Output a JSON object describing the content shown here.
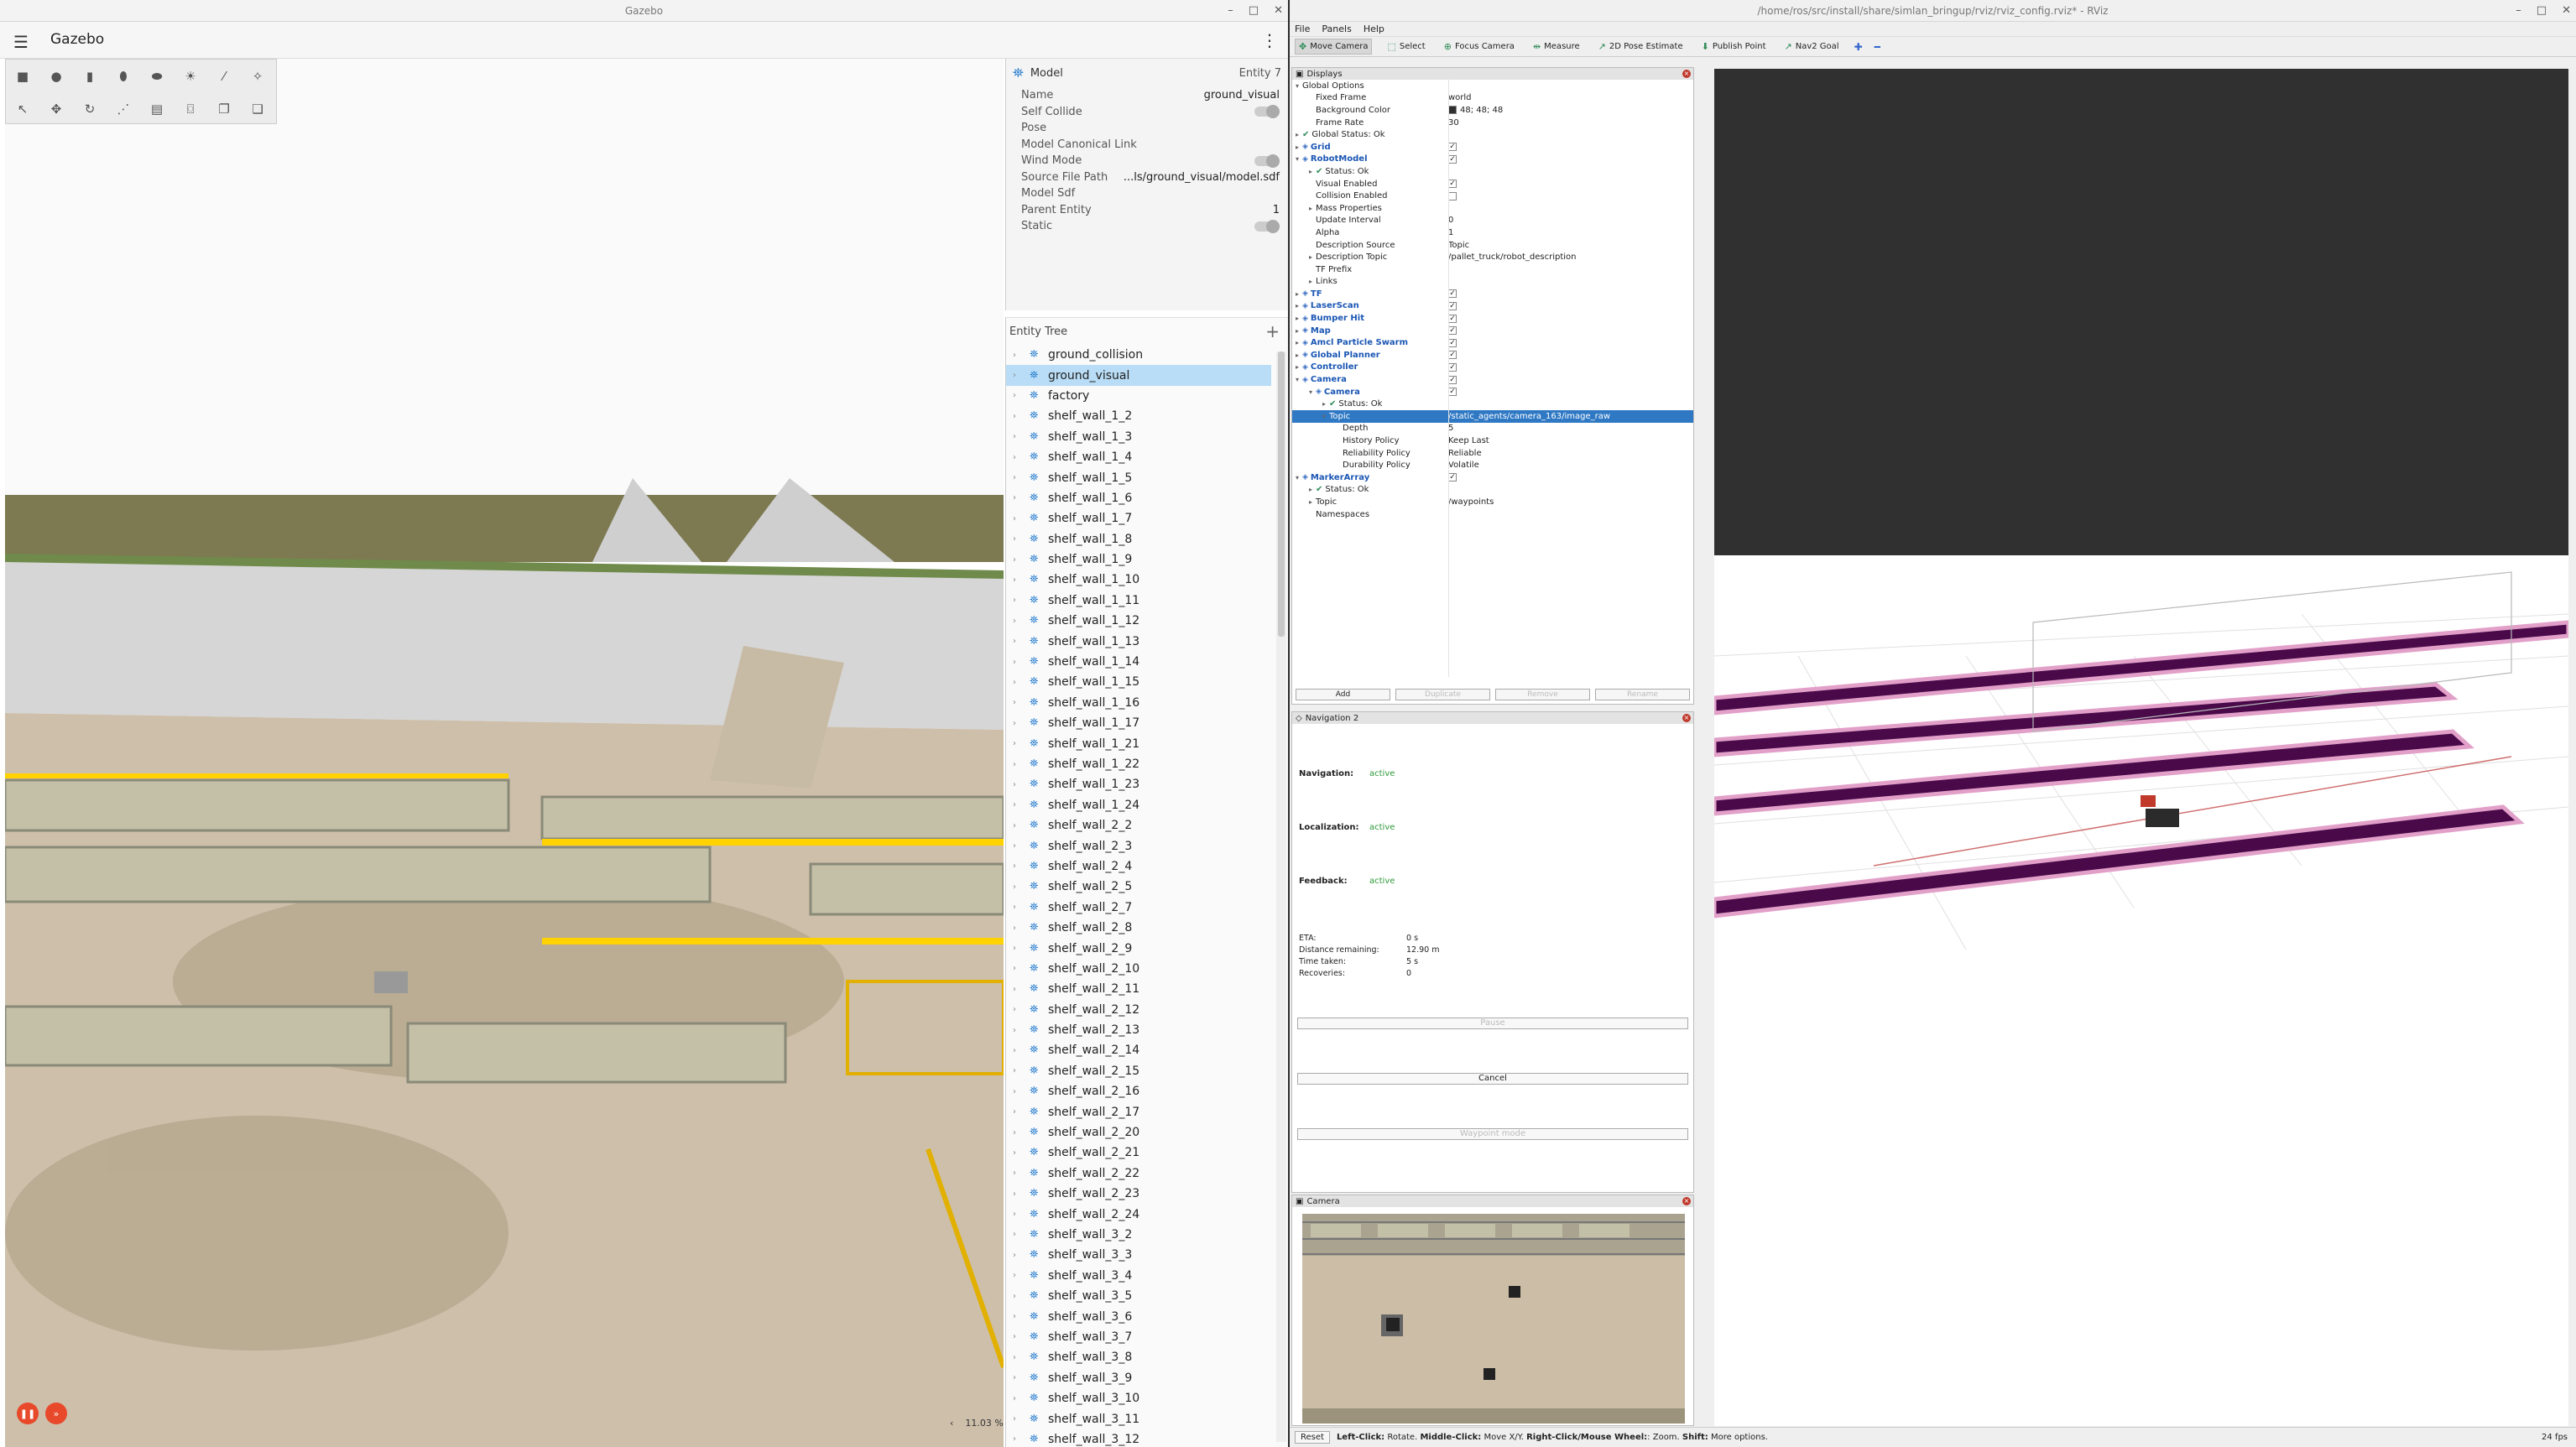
{
  "gazebo": {
    "window_title": "Gazebo",
    "app_title": "Gazebo",
    "zoom": "11.03 %",
    "component_inspector": {
      "title": "Model",
      "entity": "Entity 7",
      "props": [
        {
          "key": "Name",
          "value": "ground_visual",
          "toggle": false
        },
        {
          "key": "Self Collide",
          "value": "",
          "toggle": true
        },
        {
          "key": "Pose",
          "value": "",
          "toggle": false,
          "expand": true
        },
        {
          "key": "Model Canonical Link",
          "value": "",
          "toggle": false
        },
        {
          "key": "Wind Mode",
          "value": "",
          "toggle": true
        },
        {
          "key": "Source File Path",
          "value": "...ls/ground_visual/model.sdf",
          "toggle": false
        },
        {
          "key": "Model Sdf",
          "value": "",
          "toggle": false
        },
        {
          "key": "Parent Entity",
          "value": "1",
          "toggle": false
        },
        {
          "key": "Static",
          "value": "",
          "toggle": true
        }
      ]
    },
    "entity_tree": {
      "title": "Entity Tree",
      "items": [
        "ground_collision",
        "ground_visual",
        "factory",
        "shelf_wall_1_2",
        "shelf_wall_1_3",
        "shelf_wall_1_4",
        "shelf_wall_1_5",
        "shelf_wall_1_6",
        "shelf_wall_1_7",
        "shelf_wall_1_8",
        "shelf_wall_1_9",
        "shelf_wall_1_10",
        "shelf_wall_1_11",
        "shelf_wall_1_12",
        "shelf_wall_1_13",
        "shelf_wall_1_14",
        "shelf_wall_1_15",
        "shelf_wall_1_16",
        "shelf_wall_1_17",
        "shelf_wall_1_21",
        "shelf_wall_1_22",
        "shelf_wall_1_23",
        "shelf_wall_1_24",
        "shelf_wall_2_2",
        "shelf_wall_2_3",
        "shelf_wall_2_4",
        "shelf_wall_2_5",
        "shelf_wall_2_7",
        "shelf_wall_2_8",
        "shelf_wall_2_9",
        "shelf_wall_2_10",
        "shelf_wall_2_11",
        "shelf_wall_2_12",
        "shelf_wall_2_13",
        "shelf_wall_2_14",
        "shelf_wall_2_15",
        "shelf_wall_2_16",
        "shelf_wall_2_17",
        "shelf_wall_2_20",
        "shelf_wall_2_21",
        "shelf_wall_2_22",
        "shelf_wall_2_23",
        "shelf_wall_2_24",
        "shelf_wall_3_2",
        "shelf_wall_3_3",
        "shelf_wall_3_4",
        "shelf_wall_3_5",
        "shelf_wall_3_6",
        "shelf_wall_3_7",
        "shelf_wall_3_8",
        "shelf_wall_3_9",
        "shelf_wall_3_10",
        "shelf_wall_3_11",
        "shelf_wall_3_12"
      ],
      "selected": "ground_visual"
    }
  },
  "rviz": {
    "window_title": "/home/ros/src/install/share/simlan_bringup/rviz/rviz_config.rviz* - RViz",
    "menu": [
      "File",
      "Panels",
      "Help"
    ],
    "tools": [
      "Move Camera",
      "Select",
      "Focus Camera",
      "Measure",
      "2D Pose Estimate",
      "Publish Point",
      "Nav2 Goal"
    ],
    "displays": {
      "title": "Displays",
      "rows": [
        {
          "indent": 0,
          "arrow": "▾",
          "label": "Global Options",
          "value": "",
          "bold": false,
          "check": null
        },
        {
          "indent": 1,
          "arrow": "",
          "label": "Fixed Frame",
          "value": "world",
          "bold": false,
          "check": null
        },
        {
          "indent": 1,
          "arrow": "",
          "label": "Background Color",
          "value": "48; 48; 48",
          "bold": false,
          "check": null,
          "swatch": true
        },
        {
          "indent": 1,
          "arrow": "",
          "label": "Frame Rate",
          "value": "30",
          "bold": false,
          "check": null
        },
        {
          "indent": 0,
          "arrow": "▸",
          "label": "Global Status: Ok",
          "value": "",
          "bold": false,
          "check": null,
          "ok": true
        },
        {
          "indent": 0,
          "arrow": "▸",
          "label": "Grid",
          "value": "",
          "bold": true,
          "check": true
        },
        {
          "indent": 0,
          "arrow": "▾",
          "label": "RobotModel",
          "value": "",
          "bold": true,
          "check": true
        },
        {
          "indent": 1,
          "arrow": "▸",
          "label": "Status: Ok",
          "value": "",
          "bold": false,
          "check": null,
          "ok": true
        },
        {
          "indent": 1,
          "arrow": "",
          "label": "Visual Enabled",
          "value": "",
          "bold": false,
          "check": true
        },
        {
          "indent": 1,
          "arrow": "",
          "label": "Collision Enabled",
          "value": "",
          "bold": false,
          "check": false
        },
        {
          "indent": 1,
          "arrow": "▸",
          "label": "Mass Properties",
          "value": "",
          "bold": false,
          "check": null
        },
        {
          "indent": 1,
          "arrow": "",
          "label": "Update Interval",
          "value": "0",
          "bold": false,
          "check": null
        },
        {
          "indent": 1,
          "arrow": "",
          "label": "Alpha",
          "value": "1",
          "bold": false,
          "check": null
        },
        {
          "indent": 1,
          "arrow": "",
          "label": "Description Source",
          "value": "Topic",
          "bold": false,
          "check": null
        },
        {
          "indent": 1,
          "arrow": "▸",
          "label": "Description Topic",
          "value": "/pallet_truck/robot_description",
          "bold": false,
          "check": null
        },
        {
          "indent": 1,
          "arrow": "",
          "label": "TF Prefix",
          "value": "",
          "bold": false,
          "check": null
        },
        {
          "indent": 1,
          "arrow": "▸",
          "label": "Links",
          "value": "",
          "bold": false,
          "check": null
        },
        {
          "indent": 0,
          "arrow": "▸",
          "label": "TF",
          "value": "",
          "bold": true,
          "check": true
        },
        {
          "indent": 0,
          "arrow": "▸",
          "label": "LaserScan",
          "value": "",
          "bold": true,
          "check": true
        },
        {
          "indent": 0,
          "arrow": "▸",
          "label": "Bumper Hit",
          "value": "",
          "bold": true,
          "check": true
        },
        {
          "indent": 0,
          "arrow": "▸",
          "label": "Map",
          "value": "",
          "bold": true,
          "check": true
        },
        {
          "indent": 0,
          "arrow": "▸",
          "label": "Amcl Particle Swarm",
          "value": "",
          "bold": true,
          "check": true
        },
        {
          "indent": 0,
          "arrow": "▸",
          "label": "Global Planner",
          "value": "",
          "bold": true,
          "check": true
        },
        {
          "indent": 0,
          "arrow": "▸",
          "label": "Controller",
          "value": "",
          "bold": true,
          "check": true
        },
        {
          "indent": 0,
          "arrow": "▾",
          "label": "Camera",
          "value": "",
          "bold": true,
          "check": true
        },
        {
          "indent": 1,
          "arrow": "▾",
          "label": "Camera",
          "value": "",
          "bold": true,
          "check": true
        },
        {
          "indent": 2,
          "arrow": "▸",
          "label": "Status: Ok",
          "value": "",
          "bold": false,
          "check": null,
          "ok": true
        },
        {
          "indent": 2,
          "arrow": "▾",
          "label": "Topic",
          "value": "/static_agents/camera_163/image_raw",
          "bold": false,
          "check": null,
          "sel": true
        },
        {
          "indent": 3,
          "arrow": "",
          "label": "Depth",
          "value": "5",
          "bold": false,
          "check": null
        },
        {
          "indent": 3,
          "arrow": "",
          "label": "History Policy",
          "value": "Keep Last",
          "bold": false,
          "check": null
        },
        {
          "indent": 3,
          "arrow": "",
          "label": "Reliability Policy",
          "value": "Reliable",
          "bold": false,
          "check": null
        },
        {
          "indent": 3,
          "arrow": "",
          "label": "Durability Policy",
          "value": "Volatile",
          "bold": false,
          "check": null
        },
        {
          "indent": 0,
          "arrow": "▾",
          "label": "MarkerArray",
          "value": "",
          "bold": true,
          "check": true
        },
        {
          "indent": 1,
          "arrow": "▸",
          "label": "Status: Ok",
          "value": "",
          "bold": false,
          "check": null,
          "ok": true
        },
        {
          "indent": 1,
          "arrow": "▸",
          "label": "Topic",
          "value": "/waypoints",
          "bold": false,
          "check": null
        },
        {
          "indent": 1,
          "arrow": "",
          "label": "Namespaces",
          "value": "",
          "bold": false,
          "check": null
        }
      ],
      "buttons": [
        "Add",
        "Duplicate",
        "Remove",
        "Rename"
      ]
    },
    "navigation": {
      "title": "Navigation 2",
      "navigation_label": "Navigation:",
      "navigation_value": "active",
      "localization_label": "Localization:",
      "localization_value": "active",
      "feedback_label": "Feedback:",
      "feedback_value": "active",
      "stats": [
        {
          "k": "ETA:",
          "v": "0 s"
        },
        {
          "k": "Distance remaining:",
          "v": "12.90 m"
        },
        {
          "k": "Time taken:",
          "v": "5 s"
        },
        {
          "k": "Recoveries:",
          "v": "0"
        }
      ],
      "pause_label": "Pause",
      "cancel_label": "Cancel",
      "waypoint_label": "Waypoint mode"
    },
    "camera_panel": {
      "title": "Camera"
    },
    "status": {
      "reset": "Reset",
      "hint_prefix1": "Left-Click:",
      "hint_text1": " Rotate. ",
      "hint_prefix2": "Middle-Click:",
      "hint_text2": " Move X/Y. ",
      "hint_prefix3": "Right-Click/Mouse Wheel:",
      "hint_text3": ": Zoom. ",
      "hint_prefix4": "Shift:",
      "hint_text4": " More options.",
      "fps": "24 fps"
    },
    "colors": {
      "selection": "#2f78c4",
      "background": "#303030",
      "path": "#4a0a4a",
      "costmap": "#e2a0c9"
    }
  }
}
